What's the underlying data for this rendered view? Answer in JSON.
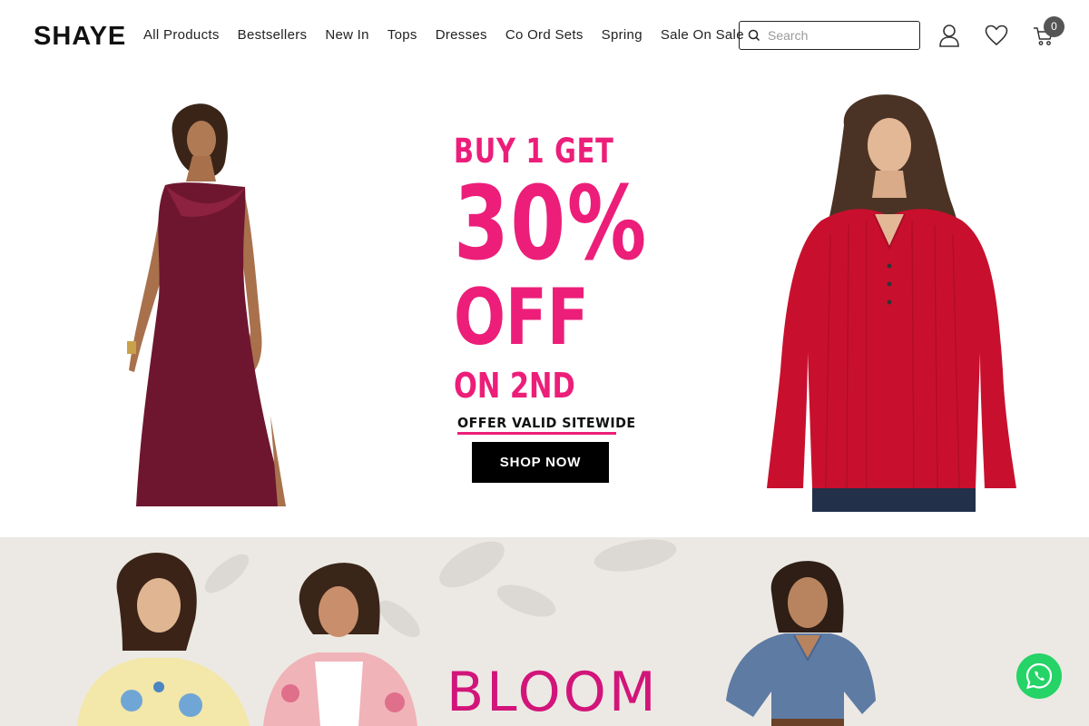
{
  "header": {
    "logo": "SHAYE",
    "nav": [
      "All Products",
      "Bestsellers",
      "New In",
      "Tops",
      "Dresses",
      "Co Ord Sets",
      "Spring",
      "Sale On Sale"
    ],
    "search_placeholder": "Search",
    "cart_count": "0"
  },
  "hero": {
    "promo_line1": "BUY 1 GET",
    "promo_big": "30%",
    "promo_off": "OFF",
    "promo_on": "ON 2ND",
    "offer_text": "OFFER VALID SITEWIDE",
    "cta_label": "SHOP NOW",
    "accent_color": "#ec1e79"
  },
  "bloom": {
    "title": "BLOOM"
  },
  "icons": {
    "search": "search-icon",
    "user": "user-icon",
    "wishlist": "heart-icon",
    "cart": "cart-icon",
    "chat": "whatsapp-icon"
  }
}
